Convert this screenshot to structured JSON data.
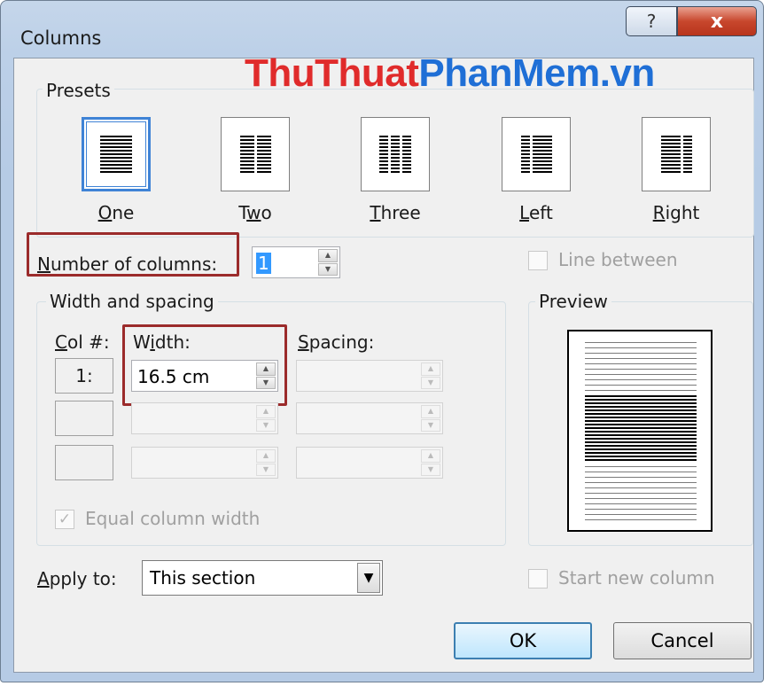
{
  "window": {
    "title": "Columns",
    "help_glyph": "?",
    "close_glyph": "x"
  },
  "watermark": {
    "part1": "ThuThuat",
    "part2": "PhanMem.vn"
  },
  "presets": {
    "group_label": "Presets",
    "items": [
      {
        "key": "O",
        "rest": "ne"
      },
      {
        "pre": "T",
        "key": "w",
        "rest": "o"
      },
      {
        "key": "T",
        "rest": "hree"
      },
      {
        "key": "L",
        "rest": "eft"
      },
      {
        "key": "R",
        "rest": "ight"
      }
    ]
  },
  "columns_count": {
    "key": "N",
    "label_rest": "umber of columns:",
    "value": "1"
  },
  "line_between": {
    "label": "Line between",
    "checked": false
  },
  "width_spacing": {
    "group_label": "Width and spacing",
    "col_header_key": "C",
    "col_header_rest": "ol #:",
    "width_header_pre": "W",
    "width_header_key": "i",
    "width_header_rest": "dth:",
    "spacing_header_key": "S",
    "spacing_header_rest": "pacing:",
    "rows": [
      {
        "col": "1:",
        "width": "16.5 cm",
        "spacing": ""
      },
      {
        "col": "",
        "width": "",
        "spacing": ""
      },
      {
        "col": "",
        "width": "",
        "spacing": ""
      }
    ],
    "equal_width": {
      "label": "Equal column width",
      "checked": true
    }
  },
  "preview": {
    "group_label": "Preview"
  },
  "apply_to": {
    "key": "A",
    "label_rest": "pply to:",
    "value": "This section"
  },
  "start_new_column": {
    "label": "Start new column",
    "checked": false
  },
  "buttons": {
    "ok": "OK",
    "cancel": "Cancel"
  },
  "icons": {
    "check": "✓",
    "dropdown": "▼",
    "spin_up": "▲",
    "spin_down": "▼"
  }
}
